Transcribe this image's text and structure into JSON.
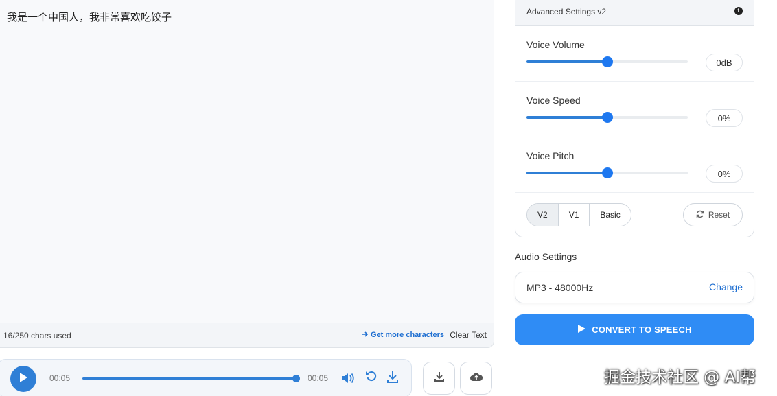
{
  "editor": {
    "text": "我是一个中国人，我非常喜欢吃饺子",
    "chars_used": "16/250 chars used",
    "get_more": "Get more characters",
    "clear_text": "Clear Text"
  },
  "player": {
    "time_current": "00:05",
    "time_total": "00:05",
    "progress": 1.0,
    "icons": [
      "play-icon",
      "volume-icon",
      "replay-icon",
      "download-icon"
    ]
  },
  "actions": {
    "icons": [
      "download-icon",
      "cloud-upload-icon"
    ]
  },
  "advanced": {
    "title": "Advanced Settings v2",
    "sliders": [
      {
        "label": "Voice Volume",
        "value": "0dB",
        "level": 0.5
      },
      {
        "label": "Voice Speed",
        "value": "0%",
        "level": 0.5
      },
      {
        "label": "Voice Pitch",
        "value": "0%",
        "level": 0.5
      }
    ],
    "versions": [
      "V2",
      "V1",
      "Basic"
    ],
    "active_version": "V2",
    "reset": "Reset"
  },
  "audio": {
    "heading": "Audio Settings",
    "format": "MP3 - 48000Hz",
    "change": "Change"
  },
  "convert": {
    "label": "CONVERT TO SPEECH"
  },
  "watermark": "掘金技术社区 @ AI帮",
  "colors": {
    "accent": "#2f8cf5",
    "slider": "#1e78f0",
    "link": "#1f6fd1"
  }
}
